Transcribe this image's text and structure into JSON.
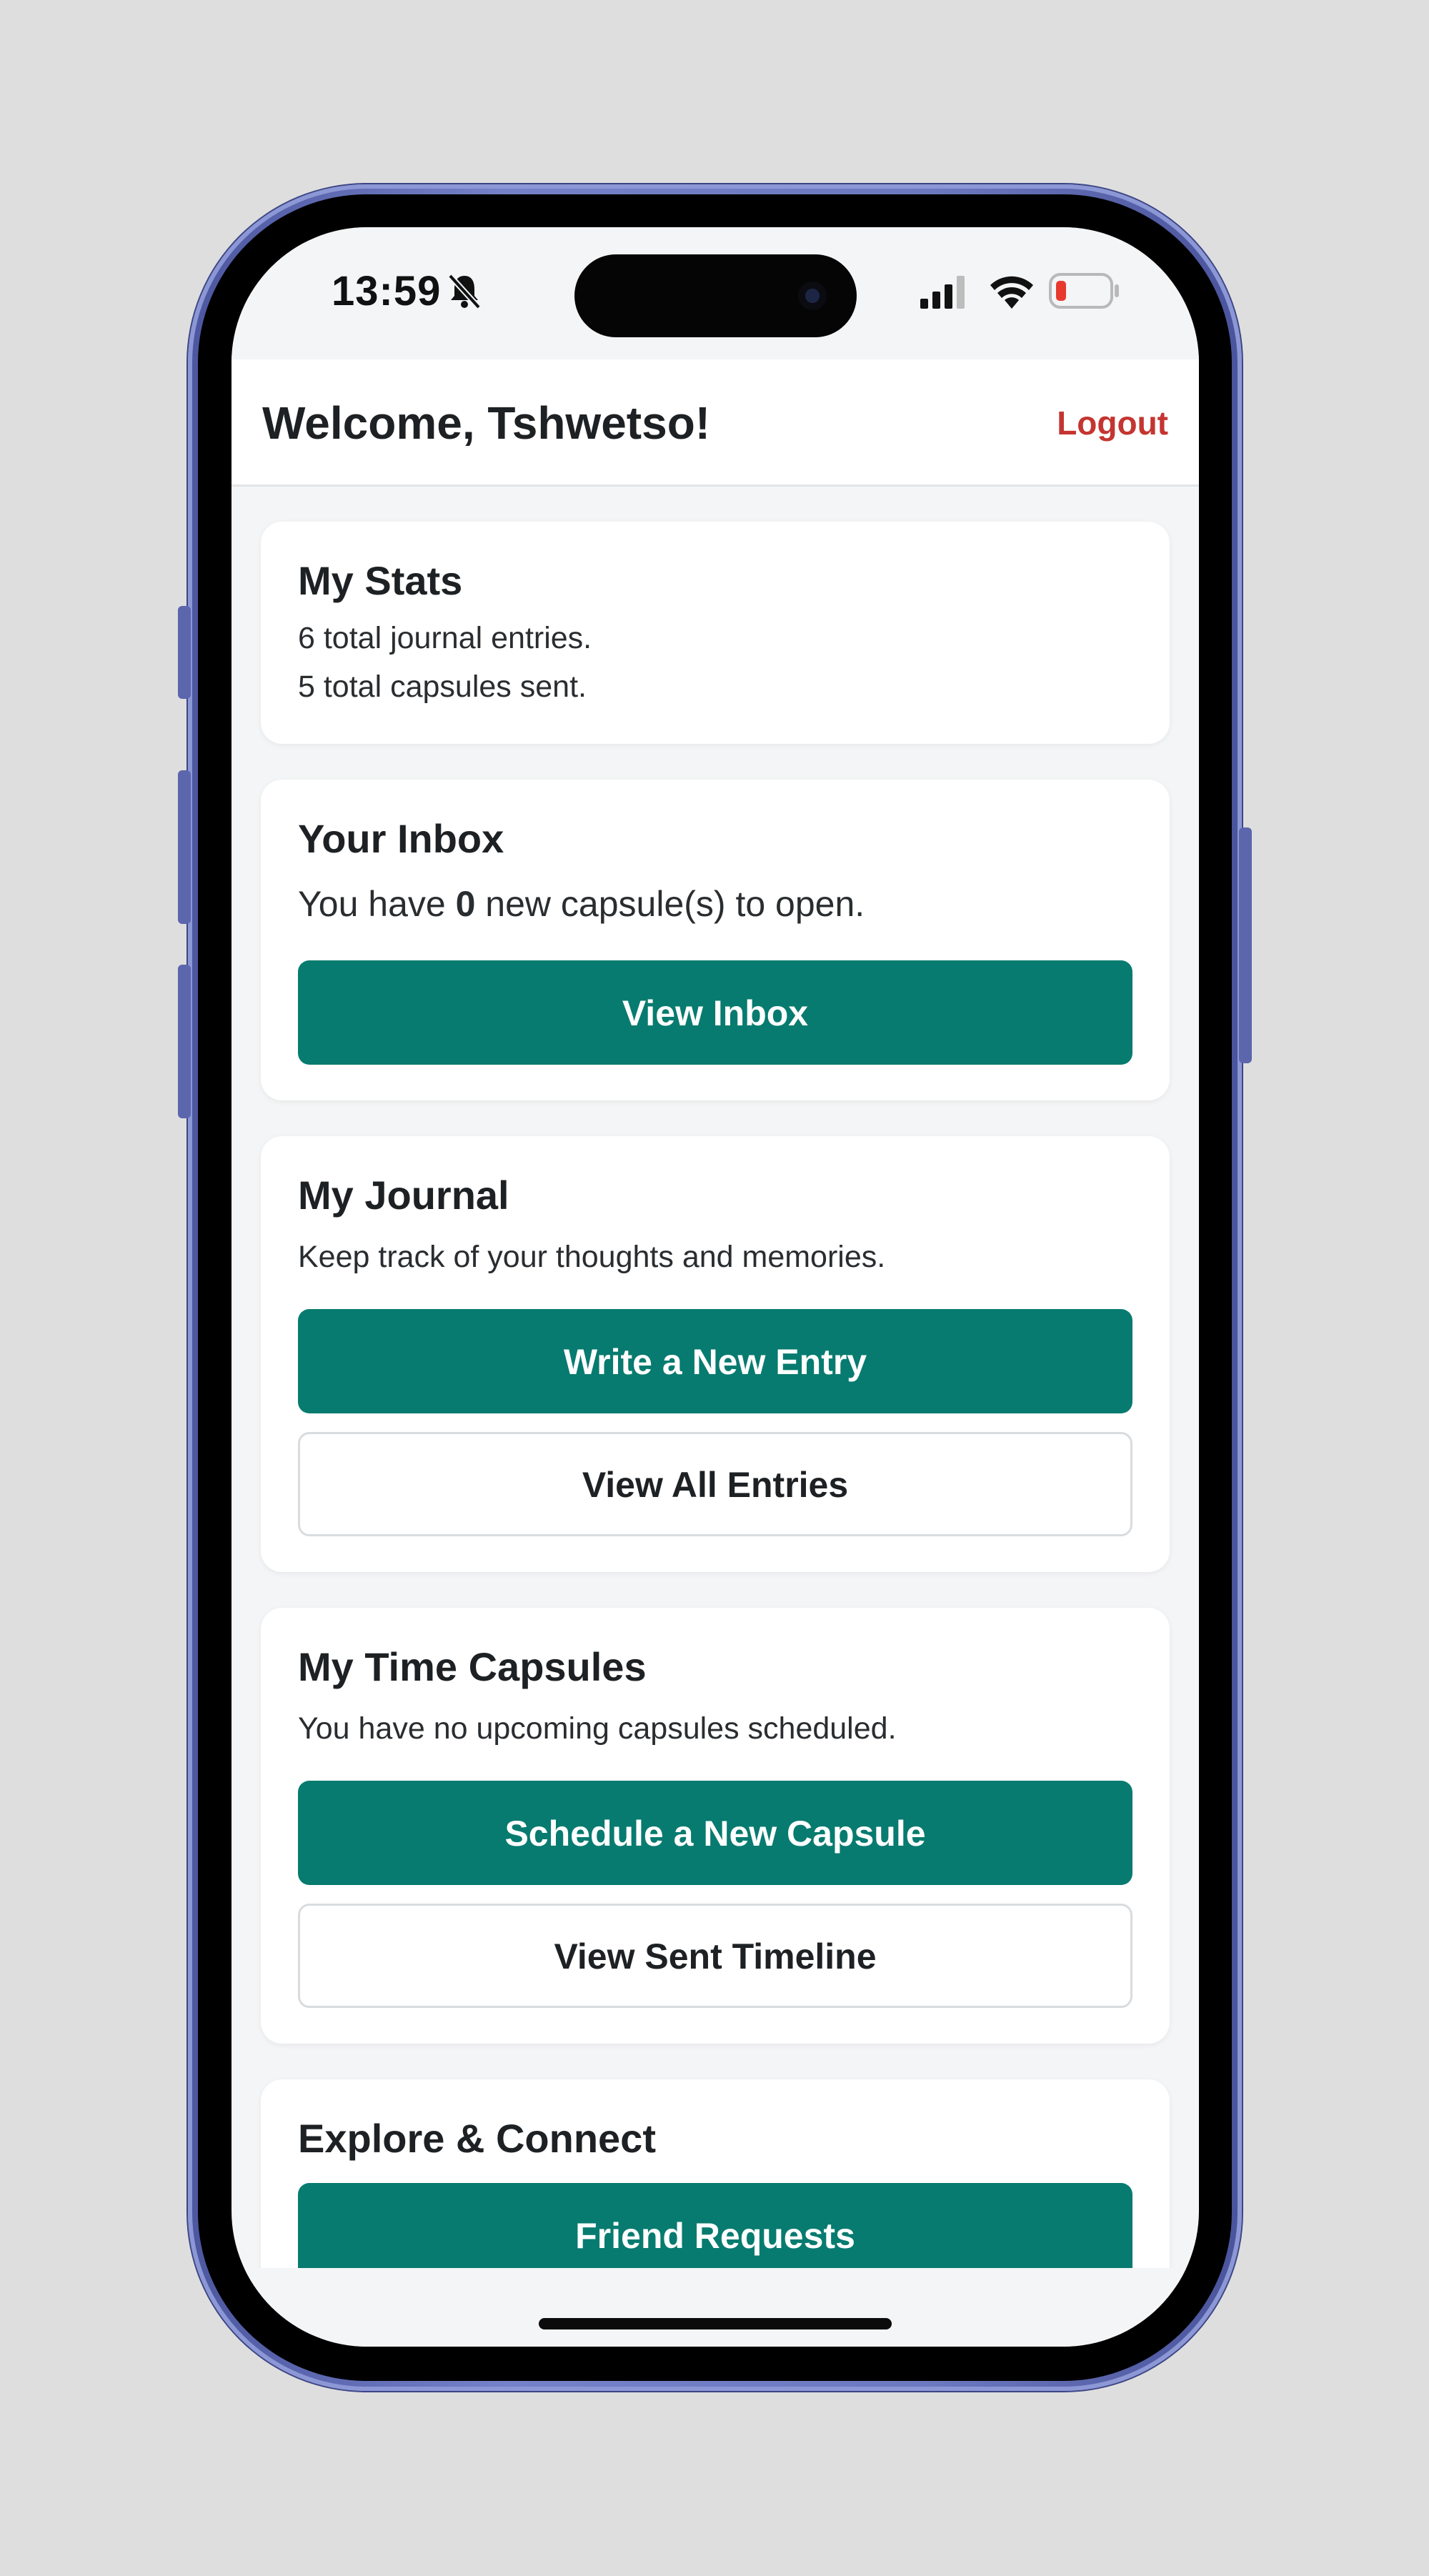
{
  "status_bar": {
    "time": "13:59",
    "icons": [
      "bell-muted-icon",
      "signal-icon",
      "wifi-icon",
      "battery-low-icon"
    ],
    "battery_color": "#e8392f"
  },
  "header": {
    "title": "Welcome, Tshwetso!",
    "logout_label": "Logout",
    "logout_color": "#c43531"
  },
  "stats": {
    "title": "My Stats",
    "journal_line": "6 total journal entries.",
    "capsules_line": "5 total capsules sent."
  },
  "inbox": {
    "title": "Your Inbox",
    "text_before": "You have ",
    "count": "0",
    "text_after": " new capsule(s) to open.",
    "button_label": "View Inbox"
  },
  "journal": {
    "title": "My Journal",
    "description": "Keep track of your thoughts and memories.",
    "primary_button": "Write a New Entry",
    "secondary_button": "View All Entries"
  },
  "capsules": {
    "title": "My Time Capsules",
    "description": "You have no upcoming capsules scheduled.",
    "primary_button": "Schedule a New Capsule",
    "secondary_button": "View Sent Timeline"
  },
  "explore": {
    "title": "Explore & Connect",
    "primary_button": "Friend Requests"
  },
  "theme": {
    "accent": "#077b6f",
    "background": "#f4f5f6",
    "phone_frame": "#6d79c0"
  }
}
